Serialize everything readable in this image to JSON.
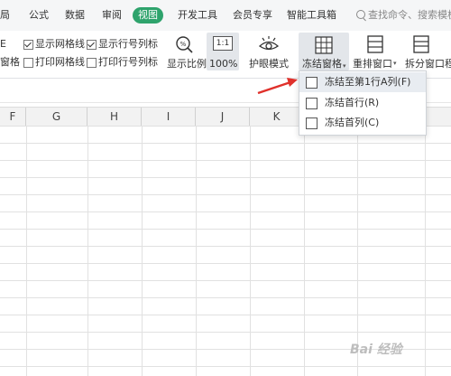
{
  "tabs": [
    "局",
    "公式",
    "数据",
    "审阅",
    "视图",
    "开发工具",
    "会员专享",
    "智能工具箱"
  ],
  "active_tab": "视图",
  "search": {
    "label": "查找命令、搜索模板"
  },
  "ribbon": {
    "row1": {
      "partial": "E",
      "gridlines": "显示网格线",
      "headings": "显示行号列标"
    },
    "row2": {
      "partial": "窗格",
      "print_gridlines": "打印网格线",
      "print_headings": "打印行号列标"
    },
    "zoom_ratio": "显示比例",
    "zoom_badge": "1:1",
    "zoom_100": "100%",
    "eye_mode": "护眼模式",
    "freeze": "冻结窗格",
    "rearrange": "重排窗口",
    "split": "拆分窗口",
    "partial_right": "程"
  },
  "freeze_menu": {
    "items": [
      {
        "label": "冻结至第1行A列(F)",
        "highlighted": true
      },
      {
        "label": "冻结首行(R)",
        "highlighted": false
      },
      {
        "label": "冻结首列(C)",
        "highlighted": false
      }
    ]
  },
  "columns": [
    "F",
    "G",
    "H",
    "I",
    "J",
    "K",
    "L",
    "M"
  ],
  "watermark": "Bai 经验",
  "colors": {
    "active_tab": "#2ea36c",
    "arrow": "#e0312b",
    "menu_highlight": "#e8ecf1"
  }
}
